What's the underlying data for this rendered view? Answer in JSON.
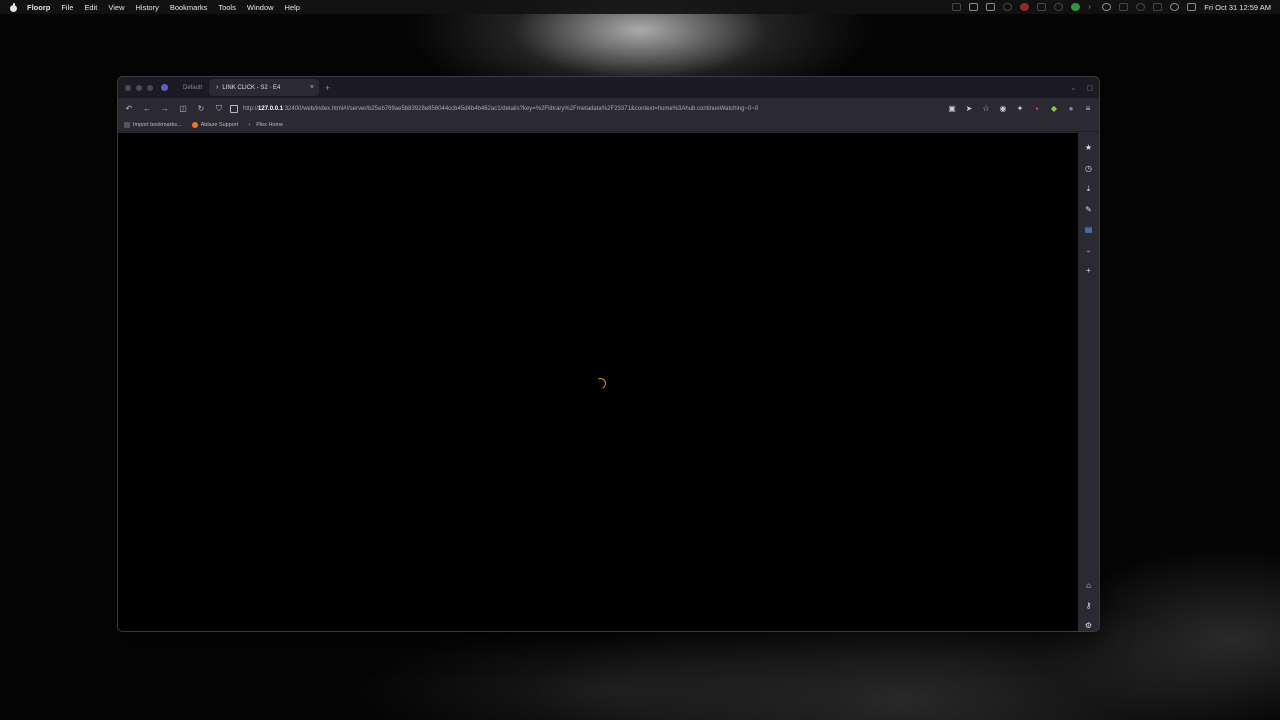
{
  "menubar": {
    "app_name": "Floorp",
    "items": [
      "File",
      "Edit",
      "View",
      "History",
      "Bookmarks",
      "Tools",
      "Window",
      "Help"
    ],
    "clock": "Fri Oct 31  12:59 AM"
  },
  "browser": {
    "tabs": [
      {
        "label": "Default"
      },
      {
        "label": "LINK CLICK - S2 · E4"
      }
    ],
    "url": {
      "prefix": "http://",
      "host": "127.0.0.1",
      "rest": ":32400/web/index.html#!/server/b25eb769ae5b83928e856044ccb45d4b4b462ac1/details?key=%2Flibrary%2Fmetadata%2F23371&context=home%3Ahub.continueWatching~0~0"
    },
    "bookmarks": [
      "Import bookmarks...",
      "Ablaze Support",
      "Plex Home"
    ]
  },
  "colors": {
    "accent": "#e5a00d",
    "browser_chrome": "#2b2a33",
    "tab_strip": "#1c1b22"
  }
}
